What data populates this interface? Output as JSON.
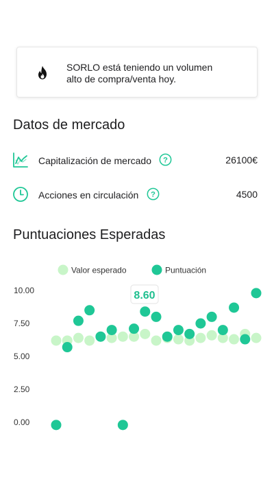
{
  "alert": {
    "icon": "fire-icon",
    "line1": "SORLO está teniendo un volumen",
    "line2": "alto de compra/venta hoy."
  },
  "market": {
    "title": "Datos de mercado",
    "rows": [
      {
        "icon": "chart-line-icon",
        "label": "Capitalización de mercado",
        "help_icon": "help-icon",
        "value": "26100€"
      },
      {
        "icon": "clock-icon",
        "label": "Acciones en circulación",
        "help_icon": "help-icon",
        "value": "4500"
      }
    ]
  },
  "scores": {
    "title": "Puntuaciones Esperadas"
  },
  "colors": {
    "accent": "#1fc796",
    "expected": "#c8f5c8",
    "text": "#1d1d1f"
  },
  "chart_data": {
    "type": "scatter",
    "title": "",
    "xlabel": "",
    "ylabel": "",
    "ylim": [
      0,
      10
    ],
    "yticks": [
      "0.00",
      "2.50",
      "5.00",
      "7.50",
      "10.00"
    ],
    "legend": "top",
    "tooltip": "8.60",
    "series": [
      {
        "name": "Valor esperado",
        "color": "#c8f5c8",
        "values": [
          6.2,
          6.2,
          6.4,
          6.2,
          6.5,
          6.4,
          6.5,
          6.5,
          6.7,
          6.2,
          6.4,
          6.3,
          6.2,
          6.4,
          6.6,
          6.4,
          6.3,
          6.7,
          6.4
        ]
      },
      {
        "name": "Puntuación",
        "color": "#1fc796",
        "values": [
          -0.2,
          5.7,
          7.7,
          8.5,
          6.5,
          7.0,
          -0.2,
          7.1,
          8.4,
          8.0,
          6.5,
          7.0,
          6.7,
          7.5,
          8.0,
          7.0,
          8.7,
          6.3,
          9.8
        ]
      }
    ]
  }
}
